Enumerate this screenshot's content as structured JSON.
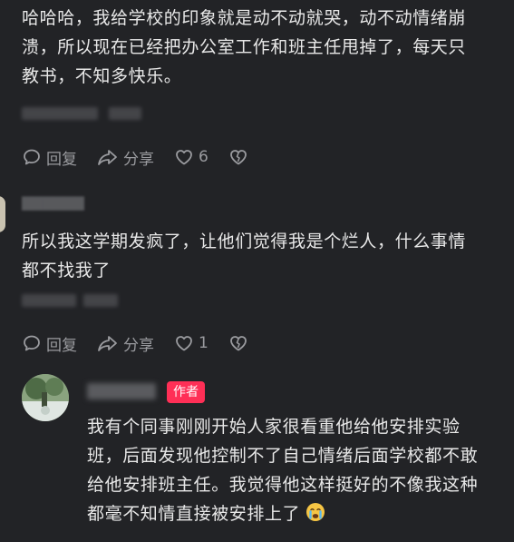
{
  "comment1": {
    "lines": [
      "哈哈哈，我给学校的印象就是动不动就哭，动不动情绪崩",
      "溃，所以现在已经把办公室工作和班主任甩掉了，每天只",
      "教书，不知多快乐。"
    ],
    "reply_label": "回复",
    "share_label": "分享",
    "like_count": "6"
  },
  "comment2": {
    "lines": [
      "所以我这学期发疯了，让他们觉得我是个烂人，什么事情",
      "都不找我了"
    ],
    "reply_label": "回复",
    "share_label": "分享",
    "like_count": "1"
  },
  "reply": {
    "badge": "作者",
    "lines": [
      "我有个同事刚刚开始人家很看重他给他安排实验",
      "班，后面发现他控制不了自己情绪后面学校都不敢",
      "给他安排班主任。我觉得他这样挺好的不像我这种",
      "都毫不知情直接被安排上了"
    ],
    "emoji": "crying-face"
  },
  "colors": {
    "background": "#222326",
    "text": "#e8e8e8",
    "muted": "#9a9b9f",
    "author_badge": "#ff2f56"
  }
}
